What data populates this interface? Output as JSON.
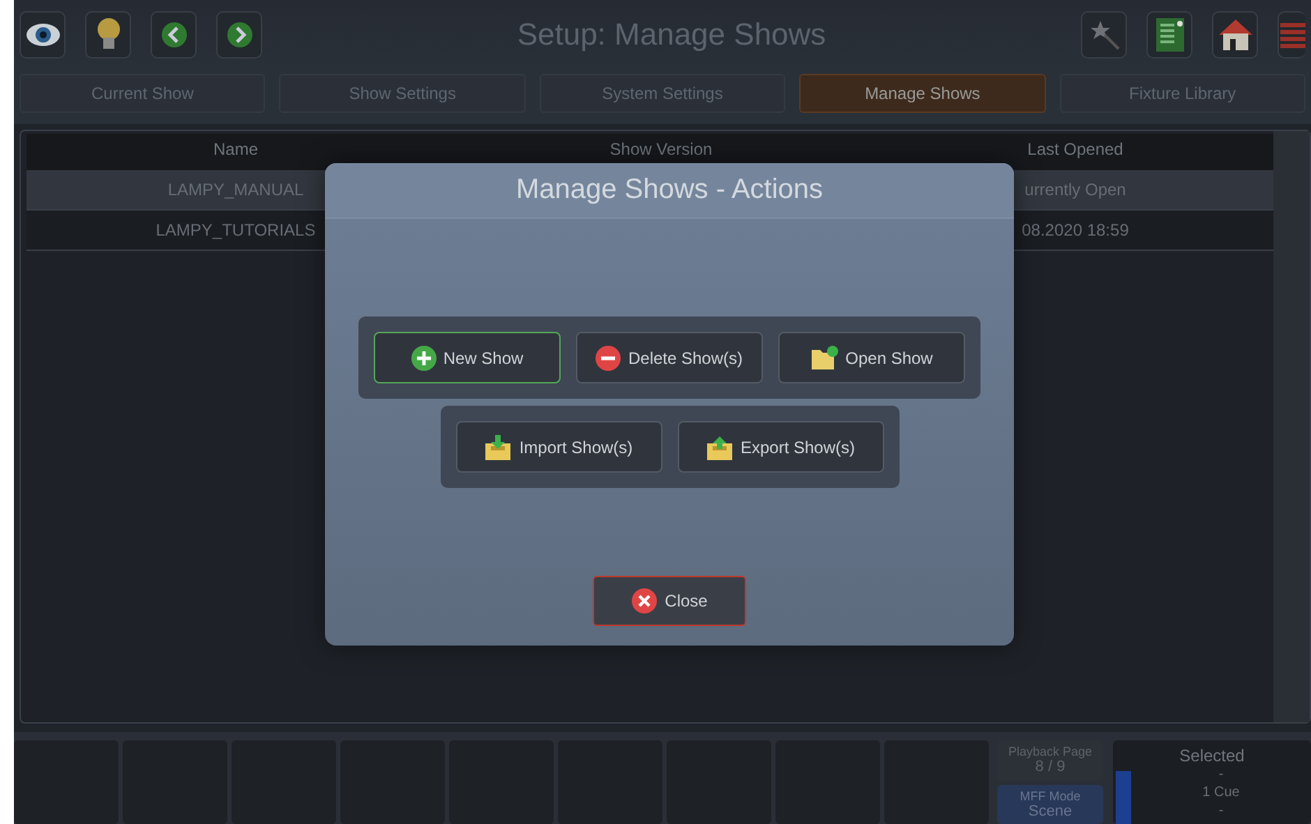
{
  "header": {
    "title": "Setup: Manage Shows"
  },
  "tabs": [
    {
      "label": "Current Show",
      "selected": false
    },
    {
      "label": "Show Settings",
      "selected": false
    },
    {
      "label": "System Settings",
      "selected": false
    },
    {
      "label": "Manage Shows",
      "selected": true
    },
    {
      "label": "Fixture Library",
      "selected": false
    }
  ],
  "table": {
    "columns": [
      "Name",
      "Show Version",
      "Last Opened"
    ],
    "rows": [
      {
        "name": "LAMPY_MANUAL",
        "last_opened": "urrently Open",
        "selected": true
      },
      {
        "name": "LAMPY_TUTORIALS",
        "last_opened": "08.2020 18:59",
        "selected": false
      }
    ]
  },
  "dialog": {
    "title": "Manage Shows - Actions",
    "groups": [
      [
        {
          "label": "New Show",
          "kind": "new",
          "focused": true
        },
        {
          "label": "Delete Show(s)",
          "kind": "delete",
          "focused": false
        },
        {
          "label": "Open Show",
          "kind": "open",
          "focused": false
        }
      ],
      [
        {
          "label": "Import Show(s)",
          "kind": "import",
          "focused": false
        },
        {
          "label": "Export Show(s)",
          "kind": "export",
          "focused": false
        }
      ]
    ],
    "close": {
      "label": "Close"
    }
  },
  "status": {
    "playback_page": {
      "label": "Playback Page",
      "value": "8 / 9"
    },
    "mff_mode": {
      "label": "MFF Mode",
      "value": "Scene"
    },
    "selected": {
      "title": "Selected",
      "lines": [
        "-",
        "1 Cue",
        "-"
      ]
    }
  }
}
